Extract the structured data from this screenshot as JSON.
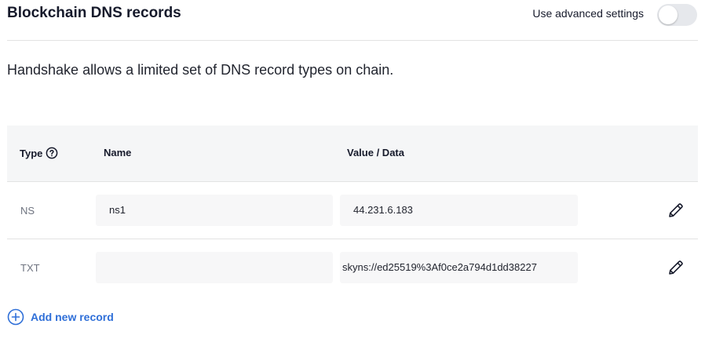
{
  "header": {
    "title": "Blockchain DNS records",
    "advanced_label": "Use advanced settings",
    "advanced_enabled": false
  },
  "description": "Handshake allows a limited set of DNS record types on chain.",
  "table": {
    "columns": {
      "type": "Type",
      "name": "Name",
      "value": "Value / Data"
    },
    "rows": [
      {
        "type": "NS",
        "name": "ns1",
        "value": "44.231.6.183"
      },
      {
        "type": "TXT",
        "name": "",
        "value": "skyns://ed25519%3Af0ce2a794d1dd38227"
      }
    ]
  },
  "add_record_label": "Add new record",
  "colors": {
    "accent": "#2f6fd8",
    "header_bg": "#f5f6f7",
    "field_bg": "#f7f7f8"
  }
}
